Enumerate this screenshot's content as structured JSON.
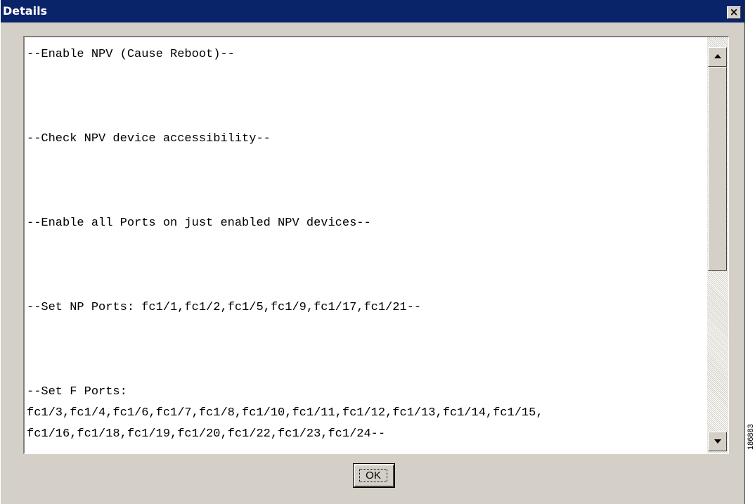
{
  "window": {
    "title": "Details",
    "close_label": "×"
  },
  "details": {
    "lines": [
      "--Enable NPV (Cause Reboot)--",
      "",
      "",
      "",
      "--Check NPV device accessibility--",
      "",
      "",
      "",
      "--Enable all Ports on just enabled NPV devices--",
      "",
      "",
      "",
      "--Set NP Ports: fc1/1,fc1/2,fc1/5,fc1/9,fc1/17,fc1/21--",
      "",
      "",
      "",
      "--Set F Ports:",
      "fc1/3,fc1/4,fc1/6,fc1/7,fc1/8,fc1/10,fc1/11,fc1/12,fc1/13,fc1/14,fc1/15,",
      "fc1/16,fc1/18,fc1/19,fc1/20,fc1/22,fc1/23,fc1/24--"
    ]
  },
  "buttons": {
    "ok_label": "OK"
  },
  "figure_id": "186883",
  "colors": {
    "titlebar": "#0a246a",
    "dialog_bg": "#d4d0c8"
  }
}
